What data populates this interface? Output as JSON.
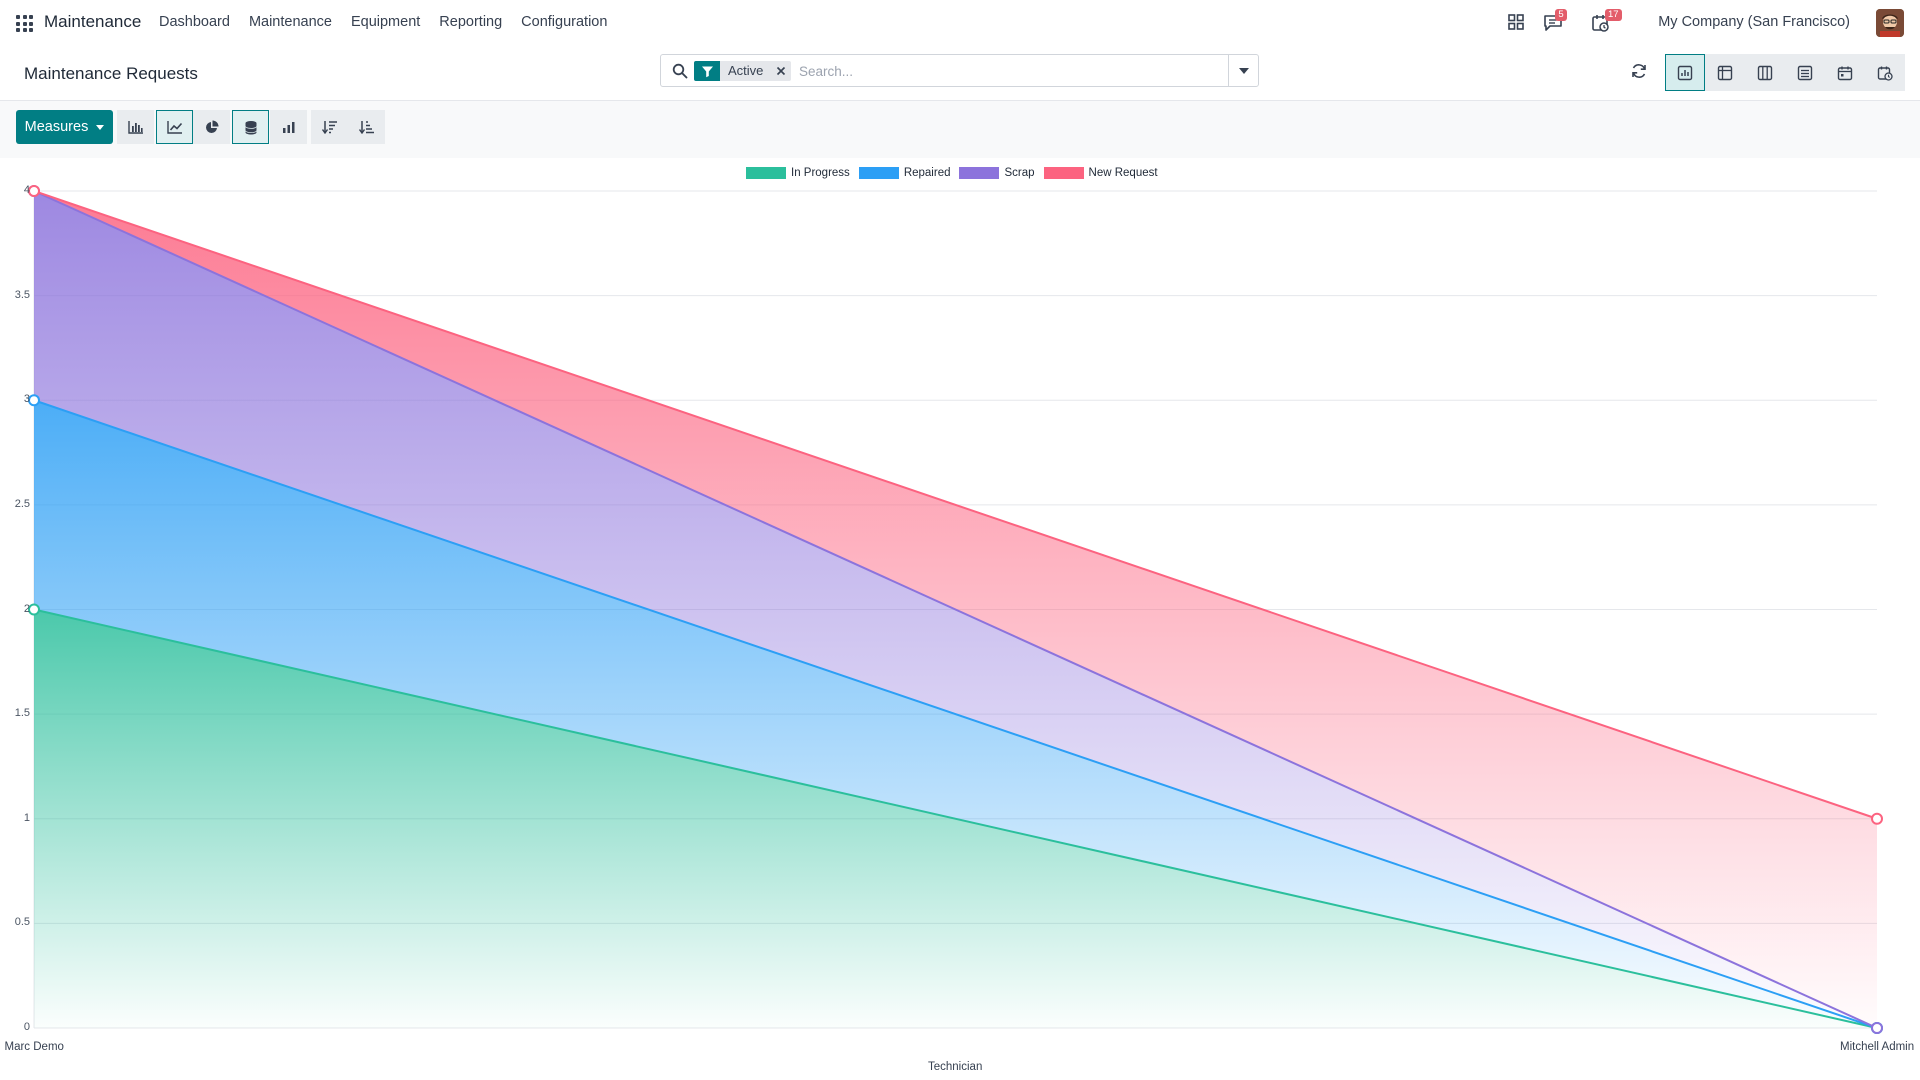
{
  "navbar": {
    "brand": "Maintenance",
    "menu": [
      "Dashboard",
      "Maintenance",
      "Equipment",
      "Reporting",
      "Configuration"
    ],
    "messages_badge": "5",
    "activities_badge": "17",
    "company": "My Company (San Francisco)"
  },
  "control_panel": {
    "title": "Maintenance Requests",
    "search": {
      "facet_value": "Active",
      "placeholder": "Search..."
    }
  },
  "toolbar": {
    "measures_label": "Measures"
  },
  "colors": {
    "accent": "#017e84",
    "in_progress": "#2bbf9c",
    "repaired": "#2c9ff5",
    "scrap": "#8c73dc",
    "new_request": "#fc6380"
  },
  "chart_data": {
    "type": "area",
    "stacked": true,
    "xlabel": "Technician",
    "x": [
      "Marc Demo",
      "Mitchell Admin"
    ],
    "ylim": [
      0,
      4
    ],
    "yticks": [
      "0",
      "0.5",
      "1",
      "1.5",
      "2",
      "2.5",
      "3",
      "3.5",
      "4"
    ],
    "series": [
      {
        "name": "In Progress",
        "color": "#2bbf9c",
        "values": [
          2,
          0
        ]
      },
      {
        "name": "Repaired",
        "color": "#2c9ff5",
        "values": [
          1,
          0
        ]
      },
      {
        "name": "Scrap",
        "color": "#8c73dc",
        "values": [
          1,
          0
        ]
      },
      {
        "name": "New Request",
        "color": "#fc6380",
        "values": [
          0,
          1
        ]
      }
    ],
    "legend_position": "top",
    "grid": true
  }
}
